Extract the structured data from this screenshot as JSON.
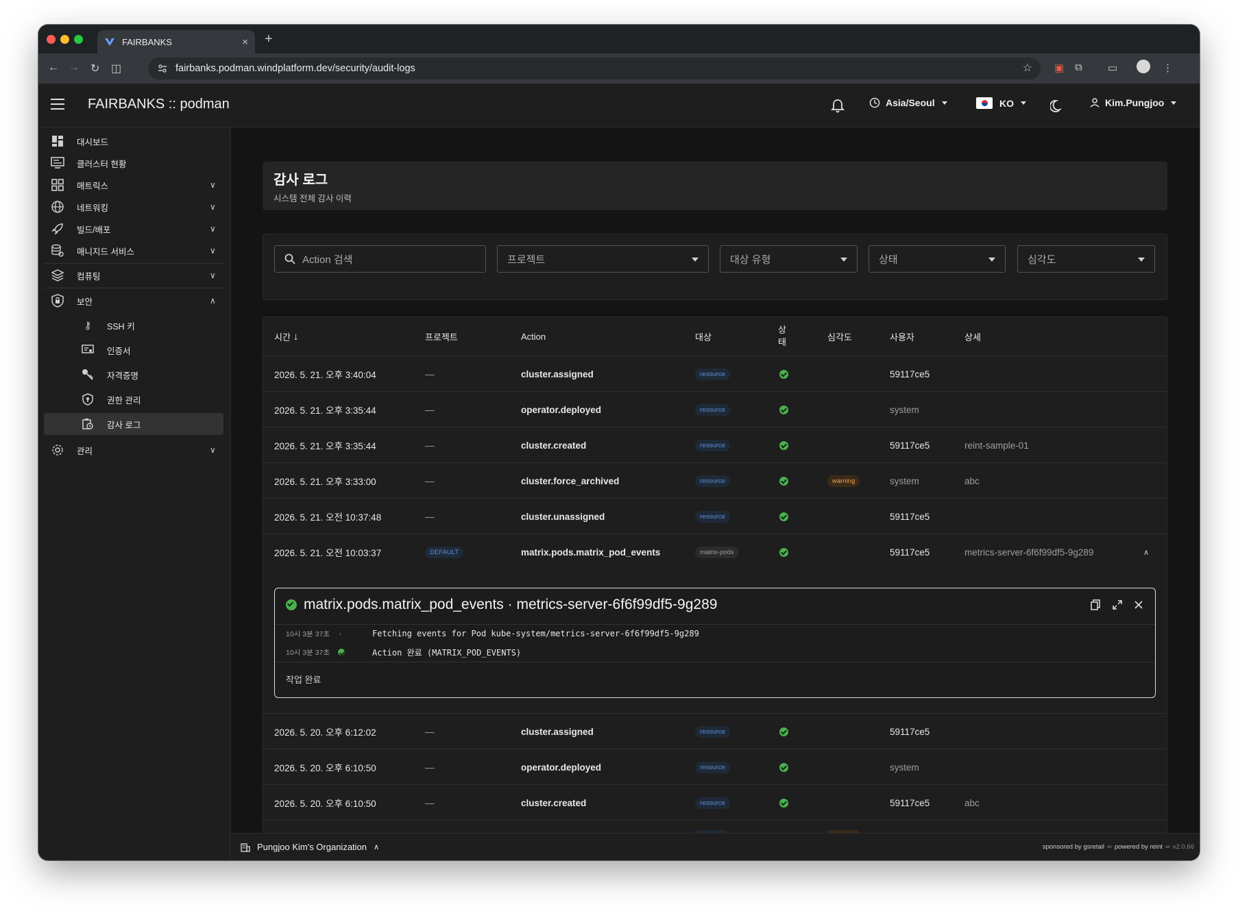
{
  "browser": {
    "tab_title": "FAIRBANKS",
    "tab_close": "×",
    "new_tab": "+",
    "url": "fairbanks.podman.windplatform.dev/security/audit-logs"
  },
  "header": {
    "title": "FAIRBANKS :: podman",
    "timezone": "Asia/Seoul",
    "language": "KO",
    "user": "Kim.Pungjoo"
  },
  "sidebar": {
    "items": [
      {
        "label": "대시보드",
        "icon": "dashboard-icon"
      },
      {
        "label": "클러스터 현황",
        "icon": "monitor-icon"
      },
      {
        "label": "매트릭스",
        "icon": "grid-icon"
      },
      {
        "label": "네트워킹",
        "icon": "globe-icon"
      },
      {
        "label": "빌드/배포",
        "icon": "rocket-icon"
      },
      {
        "label": "매니지드 서비스",
        "icon": "database-icon"
      },
      {
        "label": "컴퓨팅",
        "icon": "layers-icon"
      },
      {
        "label": "보안",
        "icon": "shield-icon"
      },
      {
        "label": "관리",
        "icon": "gear-icon"
      }
    ],
    "security_sub": [
      {
        "label": "SSH 키",
        "icon": "key-person-icon"
      },
      {
        "label": "인증서",
        "icon": "certificate-icon"
      },
      {
        "label": "자격증명",
        "icon": "key-icon"
      },
      {
        "label": "권한 관리",
        "icon": "shield-lock-icon"
      },
      {
        "label": "감사 로그",
        "icon": "audit-log-icon"
      }
    ]
  },
  "page": {
    "title": "감사 로그",
    "subtitle": "시스템 전체 감사 이력"
  },
  "filters": {
    "search_placeholder": "Action 검색",
    "project": "프로젝트",
    "target_type": "대상 유형",
    "status": "상태",
    "severity": "심각도"
  },
  "table": {
    "headers": {
      "time": "시간",
      "project": "프로젝트",
      "action": "Action",
      "target": "대상",
      "status_1": "상",
      "status_2": "태",
      "severity": "심각도",
      "user": "사용자",
      "detail": "상세"
    },
    "rows": [
      {
        "time": "2026. 5. 21. 오후 3:40:04",
        "project": "—",
        "action": "cluster.assigned",
        "target": "resource",
        "severity": "",
        "user": "59117ce5",
        "detail": ""
      },
      {
        "time": "2026. 5. 21. 오후 3:35:44",
        "project": "—",
        "action": "operator.deployed",
        "target": "resource",
        "severity": "",
        "user": "system",
        "detail": ""
      },
      {
        "time": "2026. 5. 21. 오후 3:35:44",
        "project": "—",
        "action": "cluster.created",
        "target": "resource",
        "severity": "",
        "user": "59117ce5",
        "detail": "reint-sample-01"
      },
      {
        "time": "2026. 5. 21. 오후 3:33:00",
        "project": "—",
        "action": "cluster.force_archived",
        "target": "resource",
        "severity": "warning",
        "user": "system",
        "detail": "abc"
      },
      {
        "time": "2026. 5. 21. 오전 10:37:48",
        "project": "—",
        "action": "cluster.unassigned",
        "target": "resource",
        "severity": "",
        "user": "59117ce5",
        "detail": ""
      },
      {
        "time": "2026. 5. 21. 오전 10:03:37",
        "project": "DEFAULT",
        "action": "matrix.pods.matrix_pod_events",
        "target": "matrix-pods",
        "severity": "",
        "user": "59117ce5",
        "detail": "metrics-server-6f6f99df5-9g289"
      }
    ],
    "rows_after": [
      {
        "time": "2026. 5. 20. 오후 6:12:02",
        "project": "—",
        "action": "cluster.assigned",
        "target": "resource",
        "user": "59117ce5",
        "detail": ""
      },
      {
        "time": "2026. 5. 20. 오후 6:10:50",
        "project": "—",
        "action": "operator.deployed",
        "target": "resource",
        "user": "system",
        "detail": ""
      },
      {
        "time": "2026. 5. 20. 오후 6:10:50",
        "project": "—",
        "action": "cluster.created",
        "target": "resource",
        "user": "59117ce5",
        "detail": "abc"
      }
    ]
  },
  "expanded": {
    "title": "matrix.pods.matrix_pod_events · metrics-server-6f6f99df5-9g289",
    "logs": [
      {
        "time": "10시 3분 37초",
        "message": "Fetching events for Pod kube-system/metrics-server-6f6f99df5-9g289"
      },
      {
        "time": "10시 3분 37초",
        "message": "Action 완료 (MATRIX_POD_EVENTS)"
      }
    ],
    "result": "작업 완료"
  },
  "footer": {
    "org": "Pungjoo Kim's Organization",
    "sponsored": "sponsored by gsretail",
    "powered": "powered by reint",
    "version": "v2.0.66"
  },
  "colors": {
    "accent_blue": "#5b8fd6",
    "success_green": "#4caf50",
    "warning_orange": "#f0a04b"
  }
}
